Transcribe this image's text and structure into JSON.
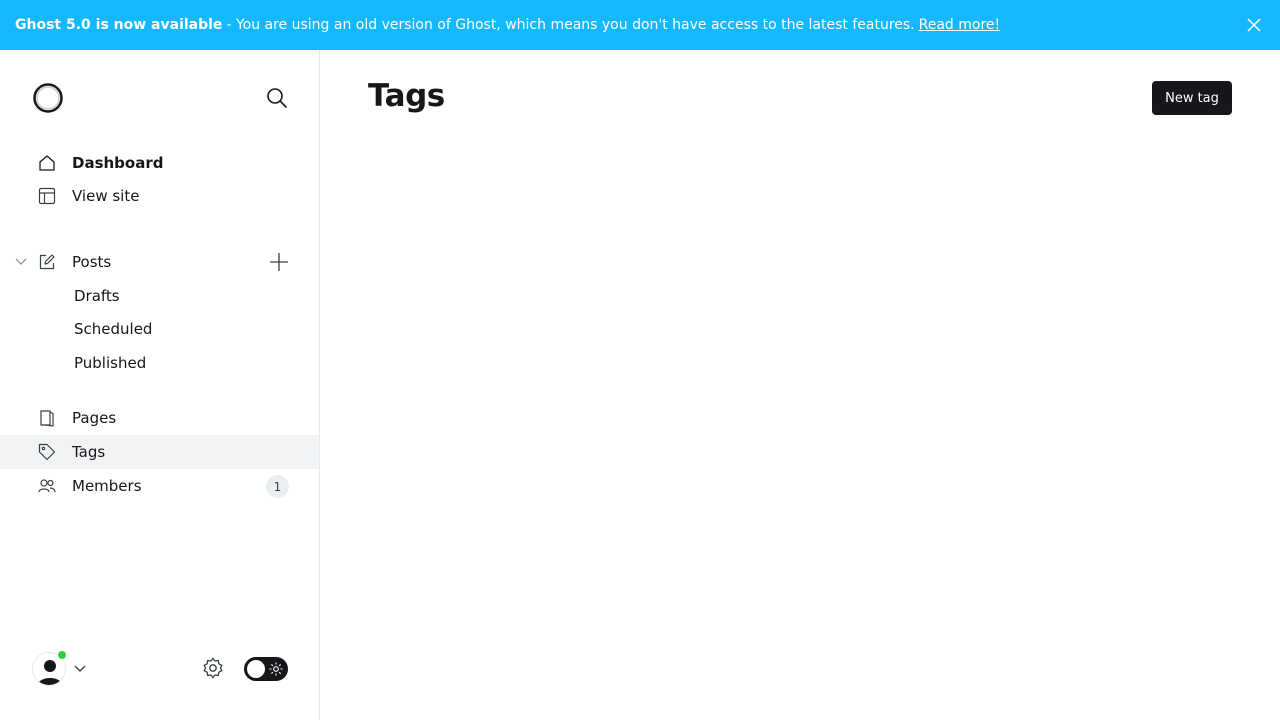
{
  "banner": {
    "title": "Ghost 5.0 is now available",
    "text": "- You are using an old version of Ghost, which means you don't have access to the latest features.",
    "link": "Read more!",
    "close_icon": "close-icon"
  },
  "sidebar": {
    "logo_icon": "ghost-logo-icon",
    "search_icon": "search-icon",
    "nav": {
      "dashboard": "Dashboard",
      "view_site": "View site",
      "posts": "Posts",
      "drafts": "Drafts",
      "scheduled": "Scheduled",
      "published": "Published",
      "pages": "Pages",
      "tags": "Tags",
      "members": "Members",
      "members_count": "1"
    },
    "active_item": "Tags",
    "footer": {
      "avatar_icon": "user-avatar-icon",
      "status_color": "#30cf43",
      "settings_icon": "gear-icon",
      "theme_toggle": "dark-mode-toggle"
    }
  },
  "main": {
    "title": "Tags",
    "new_tag_label": "New tag"
  },
  "colors": {
    "banner": "#14b8ff",
    "primary": "#15171a",
    "active_bg": "#f1f3f4"
  }
}
